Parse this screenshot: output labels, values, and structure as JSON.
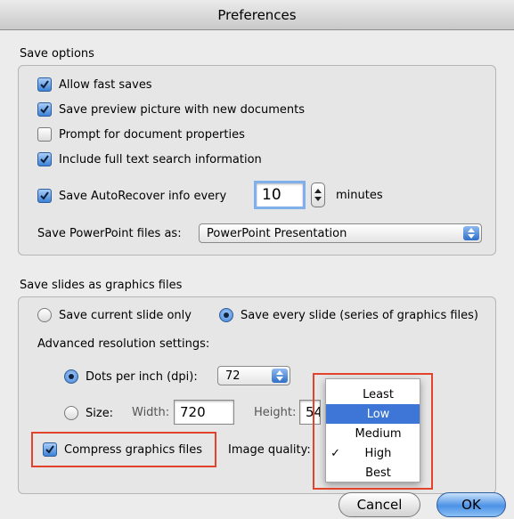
{
  "window": {
    "title": "Preferences"
  },
  "save_options": {
    "label": "Save options",
    "allow_fast_saves": {
      "label": "Allow fast saves",
      "checked": true
    },
    "save_preview": {
      "label": "Save preview picture with new documents",
      "checked": true
    },
    "prompt_properties": {
      "label": "Prompt for document properties",
      "checked": false
    },
    "include_search": {
      "label": "Include full text search information",
      "checked": true
    },
    "autorecover": {
      "label": "Save AutoRecover info every",
      "checked": true,
      "value": "10",
      "unit": "minutes"
    },
    "save_as": {
      "label": "Save PowerPoint files as:",
      "value": "PowerPoint Presentation"
    }
  },
  "graphics": {
    "label": "Save slides as graphics files",
    "current_slide": {
      "label": "Save current slide only",
      "selected": false
    },
    "every_slide": {
      "label": "Save every slide (series of graphics files)",
      "selected": true
    },
    "advanced_label": "Advanced resolution settings:",
    "dpi": {
      "label": "Dots per inch (dpi):",
      "selected": true,
      "value": "72"
    },
    "size": {
      "label": "Size:",
      "selected": false,
      "width_label": "Width:",
      "width_value": "720",
      "height_label": "Height:",
      "height_value": "54"
    },
    "compress": {
      "label": "Compress graphics files",
      "checked": true
    },
    "quality_label": "Image quality:"
  },
  "quality_menu": {
    "items": [
      {
        "label": "Least",
        "checkmark": ""
      },
      {
        "label": "Low",
        "checkmark": ""
      },
      {
        "label": "Medium",
        "checkmark": ""
      },
      {
        "label": "High",
        "checkmark": "✓"
      },
      {
        "label": "Best",
        "checkmark": ""
      }
    ],
    "highlighted_index": 1
  },
  "buttons": {
    "cancel": "Cancel",
    "ok": "OK"
  },
  "colors": {
    "highlight": "#e2432b",
    "selection": "#3d76d6",
    "accent": "#3d82d6"
  }
}
